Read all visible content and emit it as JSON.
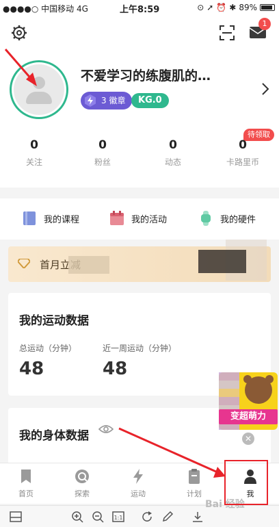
{
  "status_bar": {
    "carrier": "●●●●○ 中国移动  4G",
    "time": "上午8:59",
    "battery": "89%",
    "battery_level": 0.89
  },
  "header": {
    "username": "不爱学习的练腹肌的…",
    "badge_count": "3",
    "badge_label": "徽章",
    "kg_level": "KG.0",
    "mail_count": "1"
  },
  "stats": [
    {
      "value": "0",
      "label": "关注"
    },
    {
      "value": "0",
      "label": "粉丝"
    },
    {
      "value": "0",
      "label": "动态"
    },
    {
      "value": "0",
      "label": "卡路里币"
    }
  ],
  "pending_badge": "待领取",
  "shortcuts": [
    {
      "label": "我的课程",
      "icon": "course-icon"
    },
    {
      "label": "我的活动",
      "icon": "calendar-icon"
    },
    {
      "label": "我的硬件",
      "icon": "watch-icon"
    }
  ],
  "banner": {
    "text": "首月立减"
  },
  "sport_card": {
    "title": "我的运动数据",
    "total_label": "总运动（分钟）",
    "total_value": "48",
    "week_label": "近一周运动（分钟）",
    "week_value": "48"
  },
  "body_card": {
    "title": "我的身体数据"
  },
  "ad": {
    "ribbon_text": "变超萌力"
  },
  "tabbar": [
    {
      "label": "首页",
      "icon": "home-icon"
    },
    {
      "label": "探索",
      "icon": "explore-icon"
    },
    {
      "label": "运动",
      "icon": "lightning-icon"
    },
    {
      "label": "计划",
      "icon": "plan-icon"
    },
    {
      "label": "我",
      "icon": "person-icon"
    }
  ],
  "colors": {
    "accent_green": "#2fb88e",
    "badge_purple": "#6c5bd4",
    "red": "#e8232a"
  }
}
